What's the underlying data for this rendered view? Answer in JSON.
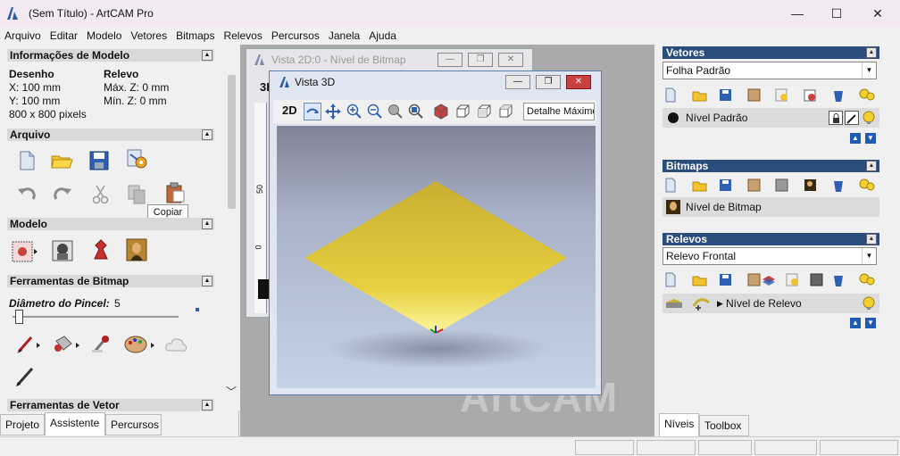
{
  "window": {
    "title": "(Sem Título) - ArtCAM Pro",
    "min": "—",
    "max": "☐",
    "close": "✕"
  },
  "menu": [
    "Arquivo",
    "Editar",
    "Modelo",
    "Vetores",
    "Bitmaps",
    "Relevos",
    "Percursos",
    "Janela",
    "Ajuda"
  ],
  "left": {
    "model_info": {
      "title": "Informações de Modelo",
      "desenho_label": "Desenho",
      "relevo_label": "Relevo",
      "x": "X: 100 mm",
      "y": "Y: 100 mm",
      "px": "800 x 800 pixels",
      "maxz": "Máx. Z: 0 mm",
      "minz": "Mín. Z: 0 mm"
    },
    "arquivo_title": "Arquivo",
    "tooltip": "Copiar",
    "modelo_title": "Modelo",
    "bitmap_tools_title": "Ferramentas de Bitmap",
    "brush_label": "Diâmetro do Pincel:",
    "brush_value": "5",
    "vector_tools_title": "Ferramentas de Vetor",
    "tabs": [
      "Projeto",
      "Assistente",
      "Percursos"
    ]
  },
  "mdi": {
    "watermark": "ArtCAM",
    "view2d": {
      "title": "Vista 2D:0 - Nível de Bitmap",
      "label": "3D",
      "tick50": "50",
      "tick0": "0"
    },
    "view3d": {
      "title": "Vista 3D",
      "btn2d": "2D",
      "detail": "Detalhe Máximo"
    }
  },
  "right": {
    "vetores": {
      "title": "Vetores",
      "combo": "Folha Padrão",
      "layer": "Nível Padrão"
    },
    "bitmaps": {
      "title": "Bitmaps",
      "layer": "Nível de Bitmap"
    },
    "relevos": {
      "title": "Relevos",
      "combo": "Relevo Frontal",
      "layer": "Nível de Relevo"
    },
    "tabs": [
      "Níveis",
      "Toolbox"
    ]
  },
  "colors": {
    "accent": "#2b4d7b",
    "relief": "#e0c030"
  }
}
